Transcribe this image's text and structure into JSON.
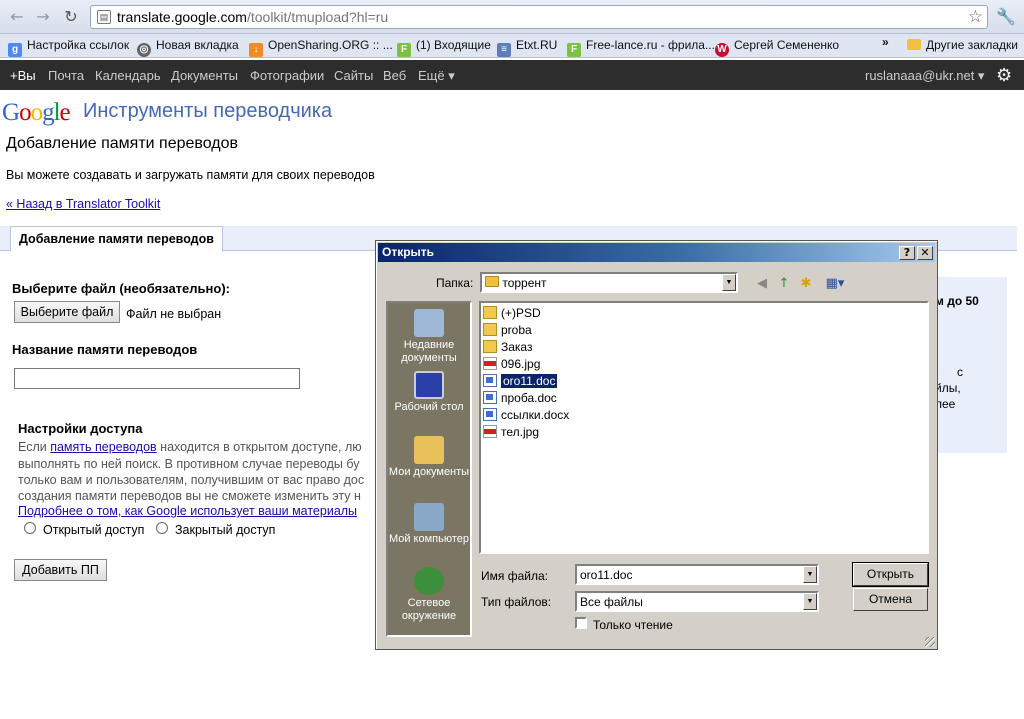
{
  "browser": {
    "url_host": "translate.google.com",
    "url_path": "/toolkit/tmupload?hl=ru",
    "bookmarks": [
      {
        "label": "Настройка ссылок",
        "icon": "google-icon",
        "color": "#4c8bf5"
      },
      {
        "label": "Новая вкладка",
        "icon": "globe-icon",
        "color": "#666666"
      },
      {
        "label": "OpenSharing.ORG :: ...",
        "icon": "download-icon",
        "color": "#f08a24"
      },
      {
        "label": "(1) Входящие",
        "icon": "f-icon",
        "color": "#7cc242"
      },
      {
        "label": "Etxt.RU",
        "icon": "list-icon",
        "color": "#5b7fbc"
      },
      {
        "label": "Free-lance.ru - фрила...",
        "icon": "f-icon",
        "color": "#7cc242"
      },
      {
        "label": "Сергей Семененко",
        "icon": "w-icon",
        "color": "#c8102e"
      }
    ],
    "overflow": "»",
    "other_bookmarks": "Другие закладки"
  },
  "gbar": {
    "links": [
      "+Вы",
      "Почта",
      "Календарь",
      "Документы",
      "Фотографии",
      "Сайты",
      "Веб",
      "Ещё ▾"
    ],
    "user": "ruslanaaa@ukr.net ▾"
  },
  "page": {
    "logo_letters": [
      "G",
      "o",
      "o",
      "g",
      "l",
      "e"
    ],
    "logo_colors": [
      "#3366cc",
      "#cc0000",
      "#f1b800",
      "#3366cc",
      "#009933",
      "#cc0000"
    ],
    "product_name": "Инструменты переводчика",
    "title": "Добавление памяти переводов",
    "description": "Вы можете создавать и загружать памяти для своих переводов",
    "back_link": "« Назад в Translator Toolkit",
    "tab_label": "Добавление памяти переводов",
    "choose_file_label": "Выберите файл (необязательно):",
    "choose_file_button": "Выберите файл",
    "no_file": "Файл не выбран",
    "tm_name_label": "Название памяти переводов",
    "access_heading": "Настройки доступа",
    "access_line1_pre": "Если ",
    "access_line1_link": "память переводов",
    "access_line1_post": " находится в открытом доступе, лю",
    "access_line2": "выполнять по ней поиск. В противном случае переводы бу",
    "access_line3": "только вам и пользователям, получившим от вас право дос",
    "access_line4": "создания памяти переводов вы не сможете изменить эту н",
    "access_more_link": "Подробнее о том, как Google использует ваши материалы",
    "radio_public": "Открытый доступ",
    "radio_private": "Закрытый доступ",
    "add_button": "Добавить ПП",
    "right_box_lines": [
      "м до 50",
      "с",
      "йлы,",
      "лее"
    ]
  },
  "dialog": {
    "title": "Открыть",
    "help_btn": "?",
    "close_btn": "✕",
    "folder_label": "Папка:",
    "folder_value": "торрент",
    "places": [
      {
        "label": "Недавние документы",
        "color": "#9fb8d8"
      },
      {
        "label": "Рабочий стол",
        "color": "#2b3fa8"
      },
      {
        "label": "Мои документы",
        "color": "#e8c15a"
      },
      {
        "label": "Мой компьютер",
        "color": "#8aa9c8"
      },
      {
        "label": "Сетевое окружение",
        "color": "#3c8f3c"
      }
    ],
    "files": [
      {
        "name": "(+)PSD",
        "type": "folder",
        "selected": false
      },
      {
        "name": "proba",
        "type": "folder",
        "selected": false
      },
      {
        "name": "Заказ",
        "type": "folder",
        "selected": false
      },
      {
        "name": "096.jpg",
        "type": "jpg",
        "selected": false
      },
      {
        "name": "oro11.doc",
        "type": "doc",
        "selected": true
      },
      {
        "name": "проба.doc",
        "type": "doc",
        "selected": false
      },
      {
        "name": "ссылки.docx",
        "type": "doc",
        "selected": false
      },
      {
        "name": "тел.jpg",
        "type": "jpg",
        "selected": false
      }
    ],
    "filename_label": "Имя файла:",
    "filename_value": "oro11.doc",
    "filetype_label": "Тип файлов:",
    "filetype_value": "Все файлы",
    "readonly_label": "Только чтение",
    "open_button": "Открыть",
    "cancel_button": "Отмена"
  }
}
